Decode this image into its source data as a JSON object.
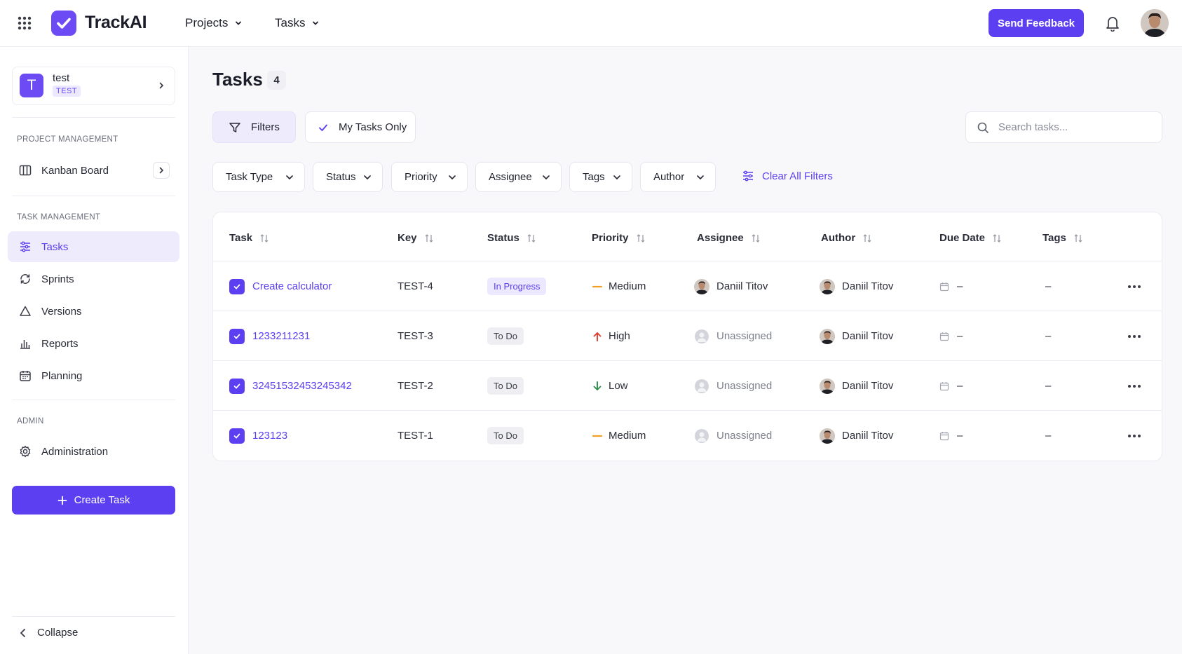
{
  "app": {
    "brand": "TrackAI",
    "nav": [
      {
        "label": "Projects"
      },
      {
        "label": "Tasks"
      }
    ],
    "feedback_label": "Send Feedback"
  },
  "colors": {
    "accent": "#5b3ff0",
    "accent_light": "#eeebfd",
    "high": "#e03a2f",
    "low": "#2f8f4a",
    "medium": "#f2a024"
  },
  "sidebar": {
    "project": {
      "avatar": "T",
      "name": "test",
      "key": "TEST"
    },
    "sections": {
      "project_management": "PROJECT MANAGEMENT",
      "task_management": "TASK MANAGEMENT",
      "admin": "ADMIN"
    },
    "kanban": "Kanban Board",
    "items": [
      {
        "label": "Tasks",
        "icon": "tasks-icon",
        "active": true
      },
      {
        "label": "Sprints",
        "icon": "sprints-icon"
      },
      {
        "label": "Versions",
        "icon": "versions-icon"
      },
      {
        "label": "Reports",
        "icon": "reports-icon"
      },
      {
        "label": "Planning",
        "icon": "calendar-icon"
      }
    ],
    "administration": "Administration",
    "create_label": "Create Task",
    "collapse_label": "Collapse"
  },
  "main": {
    "title": "Tasks",
    "count": "4",
    "filters_label": "Filters",
    "my_tasks_label": "My Tasks Only",
    "search_placeholder": "Search tasks...",
    "dropdowns": [
      "Task Type",
      "Status",
      "Priority",
      "Assignee",
      "Tags",
      "Author"
    ],
    "clear_all": "Clear All Filters"
  },
  "table": {
    "columns": [
      "Task",
      "Key",
      "Status",
      "Priority",
      "Assignee",
      "Author",
      "Due Date",
      "Tags"
    ],
    "rows": [
      {
        "task": "Create calculator",
        "key": "TEST-4",
        "status": "In Progress",
        "priority": "Medium",
        "assignee": "Daniil Titov",
        "author": "Daniil Titov",
        "due": "–",
        "tags": "–"
      },
      {
        "task": "1233211231",
        "key": "TEST-3",
        "status": "To Do",
        "priority": "High",
        "assignee": "Unassigned",
        "author": "Daniil Titov",
        "due": "–",
        "tags": "–"
      },
      {
        "task": "32451532453245342",
        "key": "TEST-2",
        "status": "To Do",
        "priority": "Low",
        "assignee": "Unassigned",
        "author": "Daniil Titov",
        "due": "–",
        "tags": "–"
      },
      {
        "task": "123123",
        "key": "TEST-1",
        "status": "To Do",
        "priority": "Medium",
        "assignee": "Unassigned",
        "author": "Daniil Titov",
        "due": "–",
        "tags": "–"
      }
    ]
  }
}
